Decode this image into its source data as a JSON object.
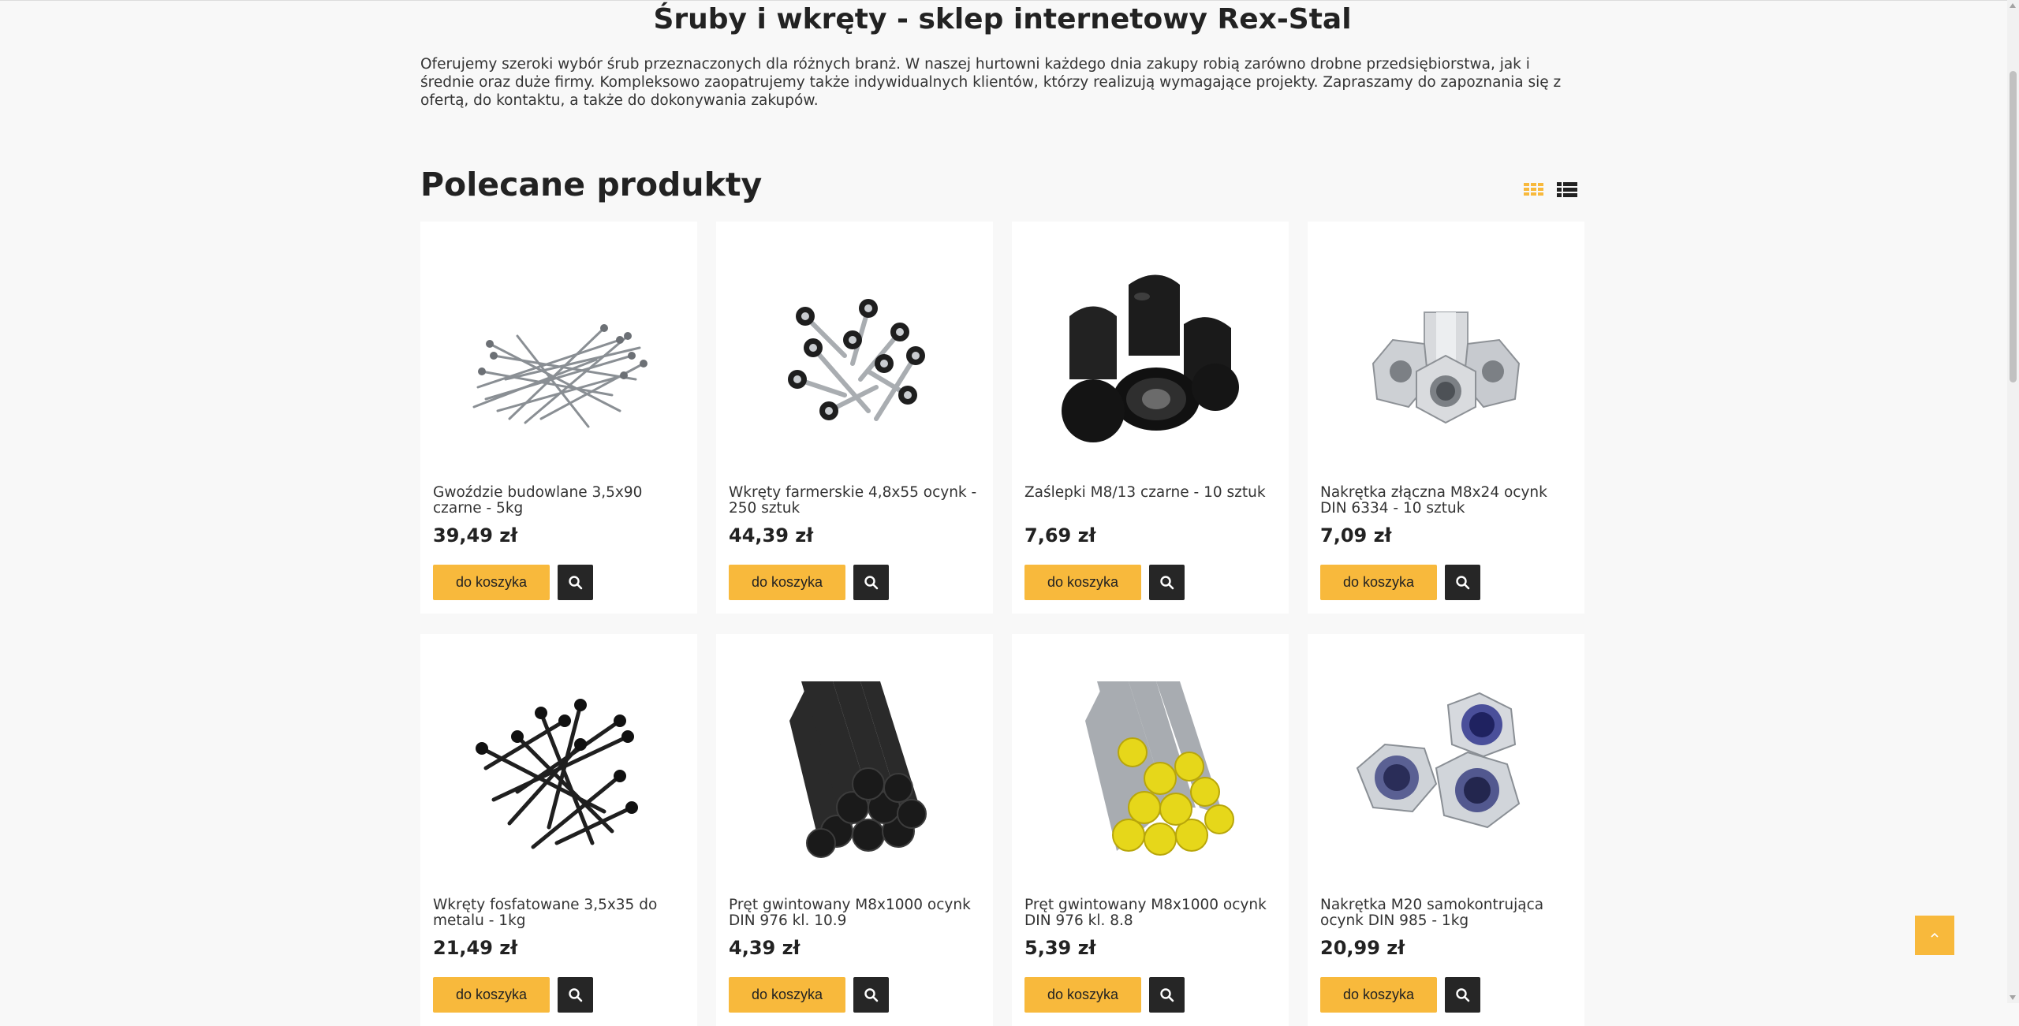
{
  "header": {
    "title": "Śruby i wkręty - sklep internetowy Rex-Stal",
    "intro": "Oferujemy szeroki wybór śrub przeznaczonych dla różnych branż. W naszej hurtowni każdego dnia zakupy robią zarówno drobne przedsiębiorstwa, jak i średnie oraz duże firmy. Kompleksowo zaopatrujemy także indywidualnych klientów, którzy realizują wymagające projekty. Zapraszamy do zapoznania się z ofertą, do kontaktu, a także do dokonywania zakupów."
  },
  "section": {
    "title": "Polecane produkty",
    "grid_icon": "grid-view-icon",
    "list_icon": "list-view-icon"
  },
  "colors": {
    "accent": "#f8b93c",
    "dark": "#262626",
    "background": "#f8f8f8"
  },
  "products": [
    {
      "name": "Gwoździe budowlane 3,5x90 czarne - 5kg",
      "price": "39,49 zł",
      "cart_label": "do koszyka",
      "icon": "nails-image"
    },
    {
      "name": "Wkręty farmerskie 4,8x55 ocynk - 250 sztuk",
      "price": "44,39 zł",
      "cart_label": "do koszyka",
      "icon": "farmer-screws-image"
    },
    {
      "name": "Zaślepki M8/13 czarne - 10 sztuk",
      "price": "7,69 zł",
      "cart_label": "do koszyka",
      "icon": "black-caps-image"
    },
    {
      "name": "Nakrętka złączna M8x24 ocynk DIN 6334 - 10 sztuk",
      "price": "7,09 zł",
      "cart_label": "do koszyka",
      "icon": "coupling-nuts-image"
    },
    {
      "name": "Wkręty fosfatowane 3,5x35 do metalu - 1kg",
      "price": "21,49 zł",
      "cart_label": "do koszyka",
      "icon": "phosphate-screws-image"
    },
    {
      "name": "Pręt gwintowany M8x1000 ocynk DIN 976 kl. 10.9",
      "price": "4,39 zł",
      "cart_label": "do koszyka",
      "icon": "black-threaded-rods-image"
    },
    {
      "name": "Pręt gwintowany M8x1000 ocynk DIN 976 kl. 8.8",
      "price": "5,39 zł",
      "cart_label": "do koszyka",
      "icon": "yellow-threaded-rods-image"
    },
    {
      "name": "Nakrętka M20 samokontrująca ocynk DIN 985 - 1kg",
      "price": "20,99 zł",
      "cart_label": "do koszyka",
      "icon": "lock-nuts-image"
    }
  ]
}
